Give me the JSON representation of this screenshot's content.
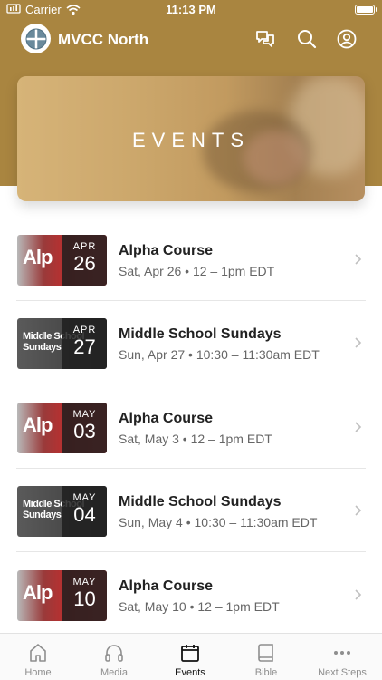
{
  "status": {
    "carrier": "Carrier",
    "time": "11:13 PM"
  },
  "app": {
    "title": "MVCC North"
  },
  "banner": {
    "title": "EVENTS"
  },
  "events": [
    {
      "title": "Alpha Course",
      "subtitle": "Sat, Apr 26 • 12 – 1pm EDT",
      "month": "APR",
      "day": "26",
      "thumb_text": "Alp"
    },
    {
      "title": "Middle School Sundays",
      "subtitle": "Sun, Apr 27 • 10:30 – 11:30am EDT",
      "month": "APR",
      "day": "27",
      "thumb_text": "Middle School Sundays"
    },
    {
      "title": "Alpha Course",
      "subtitle": "Sat, May 3 • 12 – 1pm EDT",
      "month": "MAY",
      "day": "03",
      "thumb_text": "Alp"
    },
    {
      "title": "Middle School Sundays",
      "subtitle": "Sun, May 4 • 10:30 – 11:30am EDT",
      "month": "MAY",
      "day": "04",
      "thumb_text": "Middle School Sundays"
    },
    {
      "title": "Alpha Course",
      "subtitle": "Sat, May 10 • 12 – 1pm EDT",
      "month": "MAY",
      "day": "10",
      "thumb_text": "Alp"
    }
  ],
  "tabs": [
    {
      "label": "Home",
      "icon": "home-icon"
    },
    {
      "label": "Media",
      "icon": "headphones-icon"
    },
    {
      "label": "Events",
      "icon": "calendar-icon",
      "active": true
    },
    {
      "label": "Bible",
      "icon": "book-icon"
    },
    {
      "label": "Next Steps",
      "icon": "more-icon"
    }
  ],
  "colors": {
    "header": "#a98540",
    "active_tab": "#111111",
    "inactive_tab": "#8e8e8e"
  }
}
